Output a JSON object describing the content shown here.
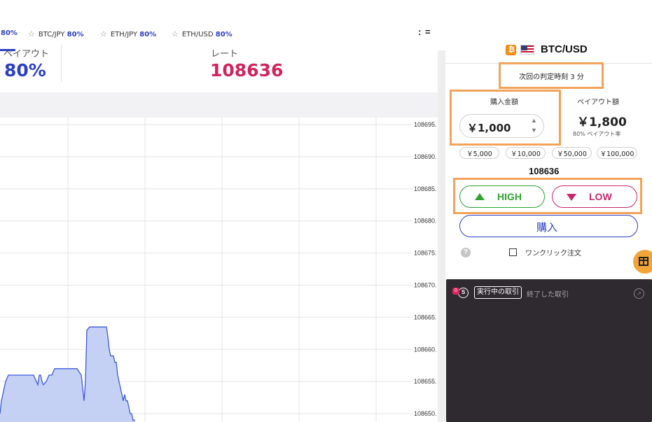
{
  "watchlist": [
    {
      "pair": "",
      "payout": "80%"
    },
    {
      "pair": "BTC/JPY",
      "payout": "80%"
    },
    {
      "pair": "ETH/JPY",
      "payout": "80%"
    },
    {
      "pair": "ETH/USD",
      "payout": "80%"
    }
  ],
  "icons": {
    "star": "☆",
    "menu": ": ="
  },
  "info": {
    "payout_label": "ペイアウト",
    "payout_value": "80%",
    "rate_label": "レート",
    "rate_value": "108636"
  },
  "chart_data": {
    "type": "area",
    "y_ticks": [
      "108695.",
      "108690.",
      "108685.",
      "108680.",
      "108675.",
      "108670.",
      "108665.",
      "108660.",
      "108655.",
      "108650."
    ],
    "ylim": [
      108648,
      108697
    ],
    "series": [
      {
        "x": [
          0,
          2,
          6,
          8,
          12,
          14,
          18,
          20,
          25,
          30,
          40,
          48,
          52,
          54,
          56,
          58,
          60,
          62,
          66,
          70,
          74,
          78,
          80,
          82,
          86,
          90,
          94,
          98,
          104,
          110,
          116,
          118,
          120,
          122,
          124,
          128,
          132,
          136,
          140,
          144,
          148,
          152,
          154,
          156,
          158,
          160,
          162,
          164,
          166,
          168,
          170,
          172,
          174,
          176,
          178,
          180,
          182,
          184,
          186,
          188,
          190,
          192,
          193
        ],
        "y": [
          108650,
          108652,
          108654,
          108655,
          108656,
          108656,
          108656,
          108656,
          108656,
          108656,
          108656,
          108656,
          108655,
          108654.5,
          108656,
          108656,
          108655,
          108654.5,
          108655,
          108656,
          108656,
          108657,
          108657,
          108657,
          108657,
          108657,
          108657,
          108657,
          108657,
          108657,
          108656,
          108654,
          108652,
          108655,
          108663,
          108663.5,
          108663.5,
          108663.5,
          108663.5,
          108663.5,
          108663.5,
          108663.5,
          108662,
          108660,
          108659,
          108659,
          108659,
          108658,
          108658,
          108656,
          108655,
          108654,
          108653,
          108652,
          108653,
          108652,
          108652,
          108651,
          108650,
          108650,
          108649,
          108649,
          108649
        ]
      }
    ],
    "colors": {
      "line": "#3b5bdb",
      "fill": "#c5d0f5",
      "grid": "#e4e4e4"
    }
  },
  "panel": {
    "pair": "BTC/USD",
    "next_time": "次回の判定時刻 3 分",
    "amount_label": "購入金額",
    "amount_value": "￥1,000",
    "payout_label": "ペイアウト額",
    "payout_value": "￥1,800",
    "payout_rate": "80% ペイアウト率",
    "quick_amounts": [
      "￥5,000",
      "￥10,000",
      "￥50,000",
      "￥100,000"
    ],
    "current_rate": "108636",
    "high_label": "HIGH",
    "low_label": "LOW",
    "buy_label": "購入",
    "help": "?",
    "oneclick_label": "ワンクリック注文"
  },
  "trades": {
    "badge": "0",
    "icon": "S",
    "tab_active": "実行中の取引",
    "tab_done": "終了した取引",
    "ext": "↗"
  },
  "colors": {
    "brand_blue": "#2b3fc4",
    "rate_red": "#d0245c",
    "high_green": "#2fa32f",
    "low_pink": "#c9276b",
    "highlight": "#f2a359"
  }
}
